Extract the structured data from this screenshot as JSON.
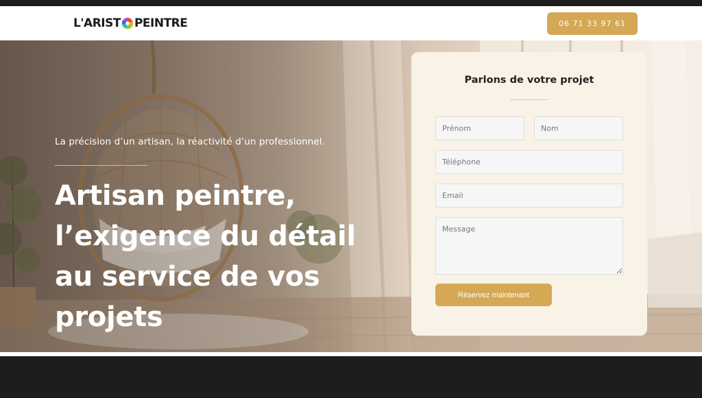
{
  "header": {
    "logo_left": "L'ARIST",
    "logo_right": "PEINTRE",
    "phone_label": "06 71 33 97 61"
  },
  "hero": {
    "tagline": "La précision d’un artisan, la réactivité d’un professionnel.",
    "headline_lines": [
      "Artisan peintre,",
      "l’exigence du détail",
      "au service de vos",
      "projets"
    ]
  },
  "form": {
    "title": "Parlons de votre projet",
    "prenom_placeholder": "Prénom",
    "nom_placeholder": "Nom",
    "telephone_placeholder": "Téléphone",
    "email_placeholder": "Email",
    "message_placeholder": "Message",
    "submit_label": "Réservez maintenant"
  },
  "colors": {
    "accent": "#d4a854",
    "form_background": "#f8f3e6",
    "dark": "#1d1d1d"
  }
}
